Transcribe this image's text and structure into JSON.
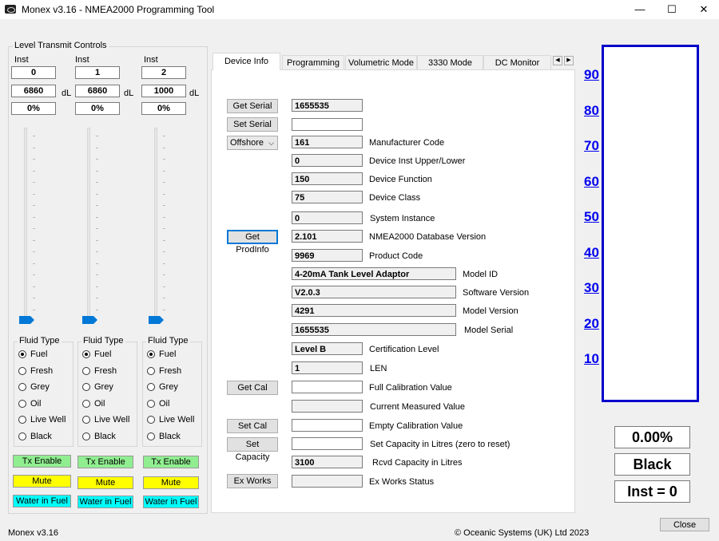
{
  "window": {
    "title": "Monex v3.16 - NMEA2000 Programming Tool",
    "minimize": "—",
    "maximize": "☐",
    "close": "✕"
  },
  "left": {
    "group_title": "Level Transmit Controls",
    "columns": [
      {
        "inst_label": "Inst",
        "inst": "0",
        "value": "6860",
        "unit": "dL",
        "percent": "0%"
      },
      {
        "inst_label": "Inst",
        "inst": "1",
        "value": "6860",
        "unit": "dL",
        "percent": "0%"
      },
      {
        "inst_label": "Inst",
        "inst": "2",
        "value": "1000",
        "unit": "dL",
        "percent": "0%"
      }
    ],
    "fluid_type_title": "Fluid Type",
    "fluid_types": [
      "Fuel",
      "Fresh",
      "Grey",
      "Oil",
      "Live Well",
      "Black"
    ],
    "selected_fluid": [
      "Fuel",
      "Fuel",
      "Fuel"
    ],
    "tx_enable": "Tx Enable",
    "mute": "Mute",
    "water_in_fuel": "Water in Fuel",
    "colors": {
      "tx": "#90ee90",
      "mute": "#ffff00",
      "water": "#00ffff"
    }
  },
  "tabs": [
    "Device Info",
    "Programming",
    "Volumetric Mode",
    "3330 Mode",
    "DC Monitor"
  ],
  "tab_scroll": {
    "left": "◀",
    "right": "▶"
  },
  "device": {
    "get_serial": "Get Serial",
    "serial": "1655535",
    "set_serial": "Set Serial",
    "set_serial_value": "",
    "mode_select": "Offshore",
    "manufacturer_code": "161",
    "manufacturer_code_label": "Manufacturer Code",
    "device_inst": "0",
    "device_inst_label": "Device Inst Upper/Lower",
    "device_function": "150",
    "device_function_label": "Device Function",
    "device_class": "75",
    "device_class_label": "Device Class",
    "system_instance": "0",
    "system_instance_label": "System Instance",
    "get_prodinfo": "Get ProdInfo",
    "db_version": "2.101",
    "db_version_label": "NMEA2000 Database Version",
    "product_code": "9969",
    "product_code_label": "Product Code",
    "model_id": "4-20mA Tank Level Adaptor",
    "model_id_label": "Model ID",
    "software_version": "V2.0.3",
    "software_version_label": "Software Version",
    "model_version": "4291",
    "model_version_label": "Model Version",
    "model_serial": "1655535",
    "model_serial_label": "Model Serial",
    "cert_level": "Level B",
    "cert_level_label": "Certification Level",
    "len": "1",
    "len_label": "LEN",
    "get_cal": "Get Cal",
    "full_cal_label": "Full Calibration Value",
    "current_measured_label": "Current Measured Value",
    "set_cal": "Set Cal",
    "empty_cal_label": "Empty Calibration Value",
    "set_capacity": "Set Capacity",
    "set_capacity_label": "Set Capacity in Litres (zero to reset)",
    "rcvd_capacity": "3100",
    "rcvd_capacity_label": "Rcvd Capacity in Litres",
    "ex_works": "Ex Works",
    "ex_works_label": "Ex Works Status"
  },
  "gauge": {
    "scale": [
      "90",
      "80",
      "70",
      "60",
      "50",
      "40",
      "30",
      "20",
      "10"
    ],
    "percent": "0.00%",
    "fluid": "Black",
    "inst": "Inst = 0",
    "border_color": "#0000cc"
  },
  "footer": {
    "version": "Monex v3.16",
    "copyright": "© Oceanic Systems (UK) Ltd 2023",
    "close": "Close"
  }
}
